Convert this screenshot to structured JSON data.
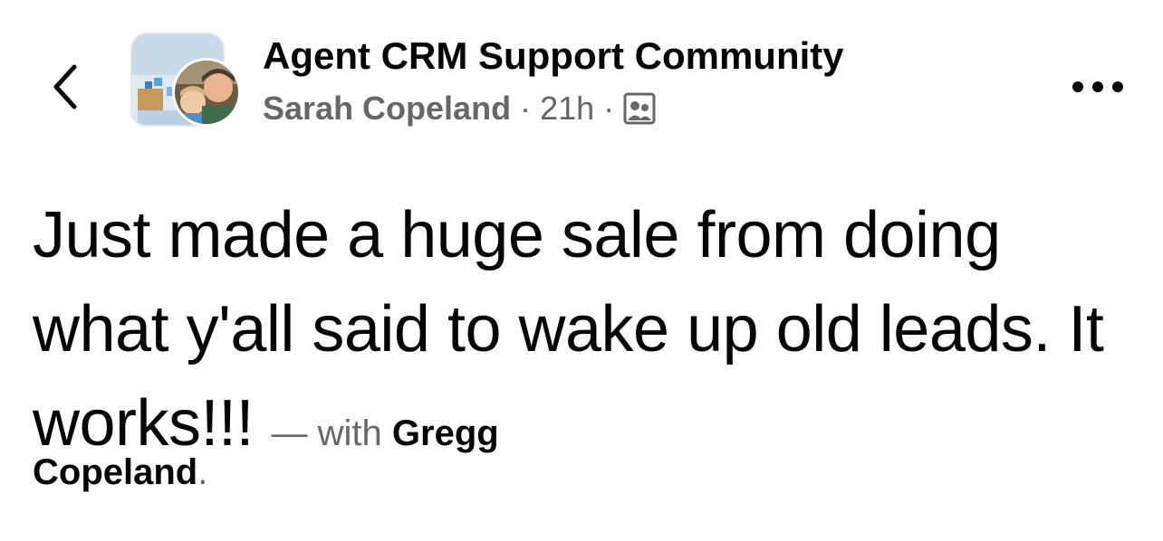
{
  "header": {
    "group_name": "Agent CRM Support Community",
    "author": "Sarah Copeland",
    "time": "21h",
    "separator": "·"
  },
  "icons": {
    "back": "chevron-left-icon",
    "privacy": "group-members-icon",
    "more": "more-horizontal-icon"
  },
  "post": {
    "text": "Just made a huge sale from doing what y'all said to wake up old leads.  It works!!!",
    "with_prefix": "— with",
    "tagged_name": "Gregg Copeland",
    "tagged_suffix": "."
  },
  "colors": {
    "primary_text": "#050505",
    "secondary_text": "#65676b"
  }
}
